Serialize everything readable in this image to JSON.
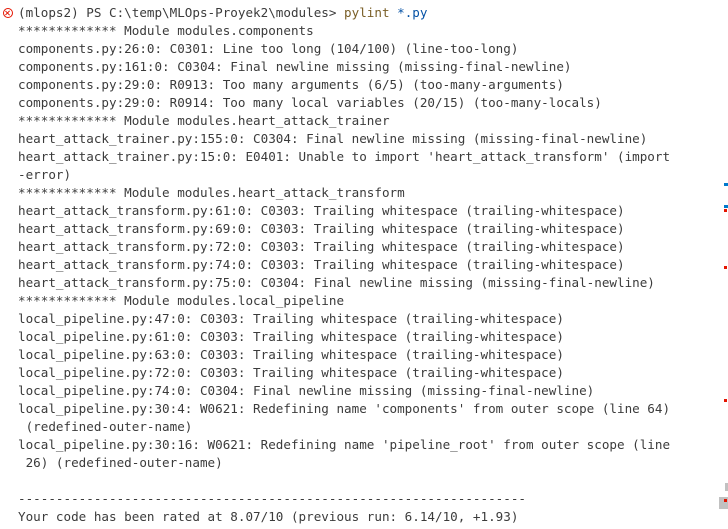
{
  "terminal": {
    "prompt": "(mlops2) PS C:\\temp\\MLOps-Proyek2\\modules>",
    "command": "pylint",
    "argument": "*.py",
    "lines": [
      "************* Module modules.components",
      "components.py:26:0: C0301: Line too long (104/100) (line-too-long)",
      "components.py:161:0: C0304: Final newline missing (missing-final-newline)",
      "components.py:29:0: R0913: Too many arguments (6/5) (too-many-arguments)",
      "components.py:29:0: R0914: Too many local variables (20/15) (too-many-locals)",
      "************* Module modules.heart_attack_trainer",
      "heart_attack_trainer.py:155:0: C0304: Final newline missing (missing-final-newline)",
      "heart_attack_trainer.py:15:0: E0401: Unable to import 'heart_attack_transform' (import",
      "-error)",
      "************* Module modules.heart_attack_transform",
      "heart_attack_transform.py:61:0: C0303: Trailing whitespace (trailing-whitespace)",
      "heart_attack_transform.py:69:0: C0303: Trailing whitespace (trailing-whitespace)",
      "heart_attack_transform.py:72:0: C0303: Trailing whitespace (trailing-whitespace)",
      "heart_attack_transform.py:74:0: C0303: Trailing whitespace (trailing-whitespace)",
      "heart_attack_transform.py:75:0: C0304: Final newline missing (missing-final-newline)",
      "************* Module modules.local_pipeline",
      "local_pipeline.py:47:0: C0303: Trailing whitespace (trailing-whitespace)",
      "local_pipeline.py:61:0: C0303: Trailing whitespace (trailing-whitespace)",
      "local_pipeline.py:63:0: C0303: Trailing whitespace (trailing-whitespace)",
      "local_pipeline.py:72:0: C0303: Trailing whitespace (trailing-whitespace)",
      "local_pipeline.py:74:0: C0304: Final newline missing (missing-final-newline)",
      "local_pipeline.py:30:4: W0621: Redefining name 'components' from outer scope (line 64)",
      " (redefined-outer-name)",
      "local_pipeline.py:30:16: W0621: Redefining name 'pipeline_root' from outer scope (line",
      " 26) (redefined-outer-name)",
      "",
      "-------------------------------------------------------------------",
      "Your code has been rated at 8.07/10 (previous run: 6.14/10, +1.93)"
    ]
  },
  "colors": {
    "background": "#ffffff",
    "text": "#3b3b3b",
    "command": "#795e26",
    "argument": "#0451a5",
    "error": "#e51400",
    "info": "#007acc"
  }
}
